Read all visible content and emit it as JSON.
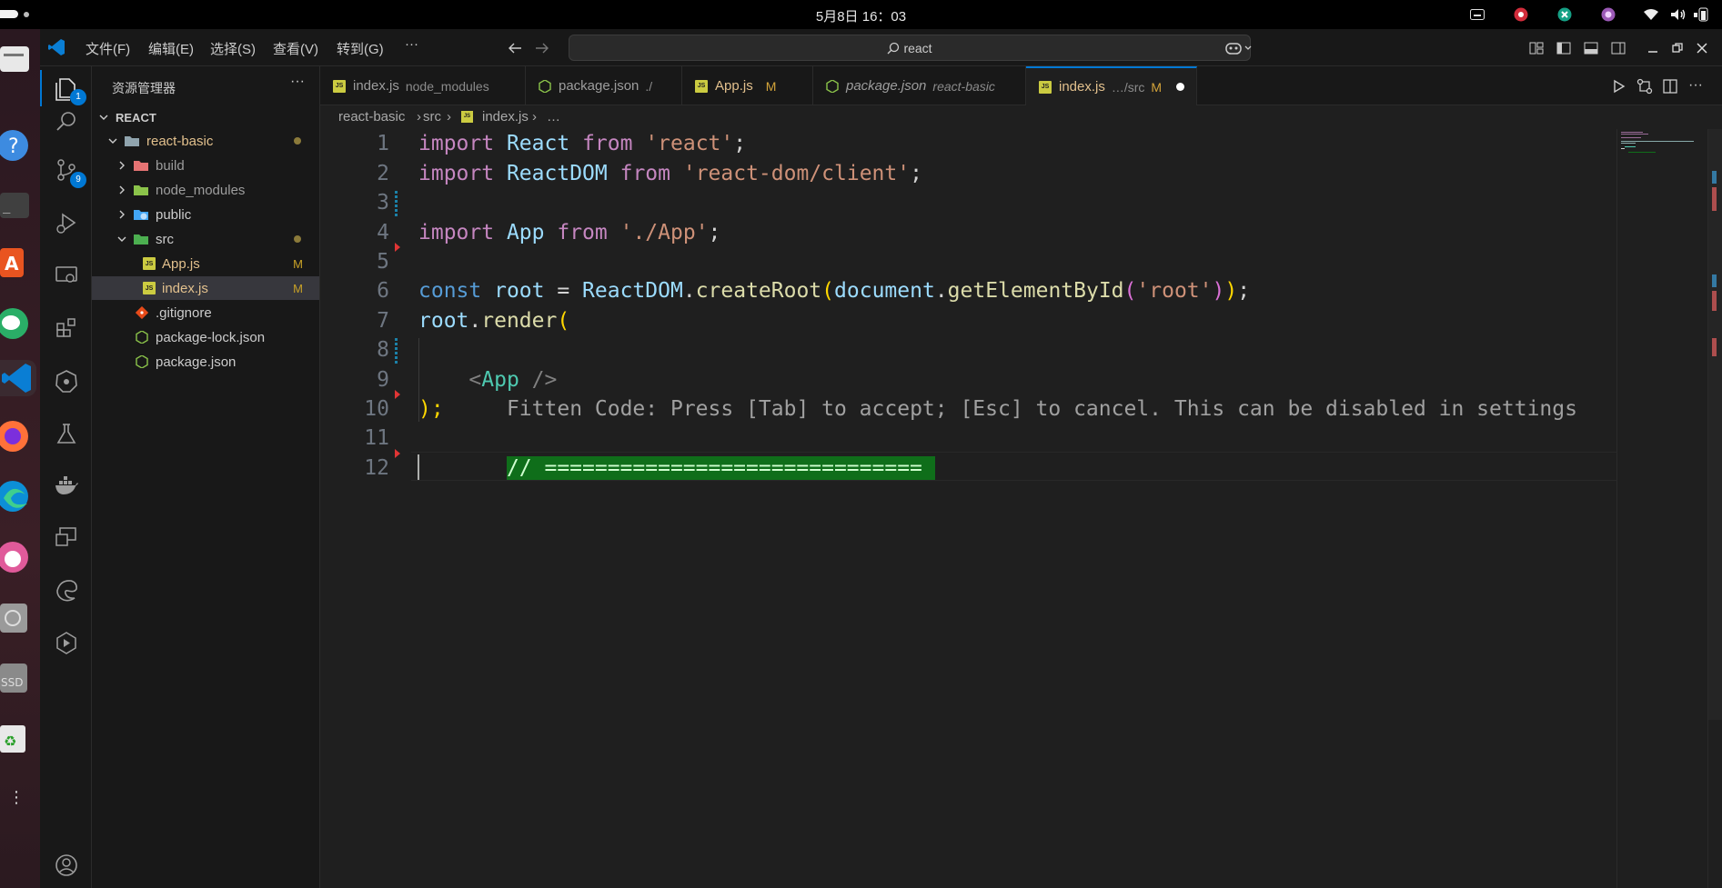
{
  "system": {
    "clock": "5月8日 16：03"
  },
  "titlebar": {
    "menus": [
      "文件(F)",
      "编辑(E)",
      "选择(S)",
      "查看(V)",
      "转到(G)"
    ],
    "more": "···",
    "search_text": "react"
  },
  "activity": {
    "explorer_badge": "1",
    "scm_badge": "9"
  },
  "sidebar": {
    "title": "资源管理器",
    "more": "···",
    "root": "REACT",
    "folder": "react-basic",
    "items": [
      {
        "label": "build"
      },
      {
        "label": "node_modules"
      },
      {
        "label": "public"
      },
      {
        "label": "src"
      },
      {
        "label": "App.js",
        "mark": "M"
      },
      {
        "label": "index.js",
        "mark": "M"
      },
      {
        "label": ".gitignore"
      },
      {
        "label": "package-lock.json"
      },
      {
        "label": "package.json"
      }
    ]
  },
  "tabs": [
    {
      "label": "index.js",
      "desc": "node_modules"
    },
    {
      "label": "package.json",
      "desc": "./"
    },
    {
      "label": "App.js",
      "mod": "M"
    },
    {
      "label": "package.json",
      "desc": "react-basic"
    },
    {
      "label": "index.js",
      "desc": "…/src",
      "mod": "M"
    }
  ],
  "breadcrumb": [
    "react-basic",
    "src",
    "index.js",
    "…"
  ],
  "editor": {
    "line_numbers": [
      "1",
      "2",
      "3",
      "4",
      "5",
      "6",
      "7",
      "8",
      "9",
      "10",
      "11",
      "12"
    ],
    "l1": {
      "kw1": "import",
      "id": "React",
      "kw2": "from",
      "str": "'react'",
      "end": ";"
    },
    "l2": {
      "kw1": "import",
      "id": "ReactDOM",
      "kw2": "from",
      "str": "'react-dom/client'",
      "end": ";"
    },
    "l4": {
      "kw1": "import",
      "id": "App",
      "kw2": "from",
      "str": "'./App'",
      "end": ";"
    },
    "l6": {
      "const": "const",
      "root": "root",
      "eq": " = ",
      "obj": "ReactDOM",
      "dot1": ".",
      "fn1": "createRoot",
      "p1": "(",
      "doc": "document",
      "dot2": ".",
      "fn2": "getElementById",
      "p2": "(",
      "str": "'root'",
      "p3": ")",
      "p4": ")",
      "end": ";"
    },
    "l7": {
      "root": "root",
      "dot": ".",
      "fn": "render",
      "p": "("
    },
    "l9": {
      "lt": "<",
      "comp": "App",
      "close": " />"
    },
    "l10": {
      "end": ");",
      "ghost": "Fitten Code: Press [Tab] to accept; [Esc] to cancel. This can be disabled in settings"
    },
    "l12": {
      "suggestion": "// ============================== "
    }
  }
}
